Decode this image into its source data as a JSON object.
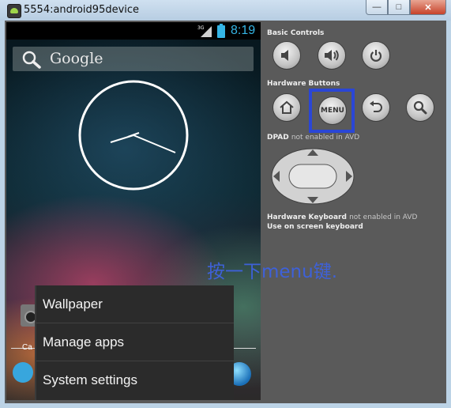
{
  "window": {
    "title": "5554:android95device",
    "minimize_glyph": "—",
    "maximize_glyph": "□",
    "close_glyph": "✕"
  },
  "status_bar": {
    "network": "3G",
    "time": "8:19"
  },
  "home": {
    "search_label": "Google",
    "dock_label": "Ca"
  },
  "menu": {
    "items": [
      {
        "label": "Wallpaper"
      },
      {
        "label": "Manage apps"
      },
      {
        "label": "System settings"
      }
    ]
  },
  "controls": {
    "basic_controls_label": "Basic Controls",
    "hardware_buttons_label": "Hardware Buttons",
    "menu_button_label": "MENU",
    "dpad_label": "DPAD",
    "dpad_note": "not enabled in AVD",
    "keyboard_label": "Hardware Keyboard",
    "keyboard_note": "not enabled in AVD",
    "onscreen_keyboard_label": "Use on screen keyboard"
  },
  "annotation": {
    "text": "按一下menu键."
  },
  "colors": {
    "annotation": "#3e61d8",
    "menu_highlight_border": "#2a46d6",
    "status_accent": "#35b5e5"
  }
}
